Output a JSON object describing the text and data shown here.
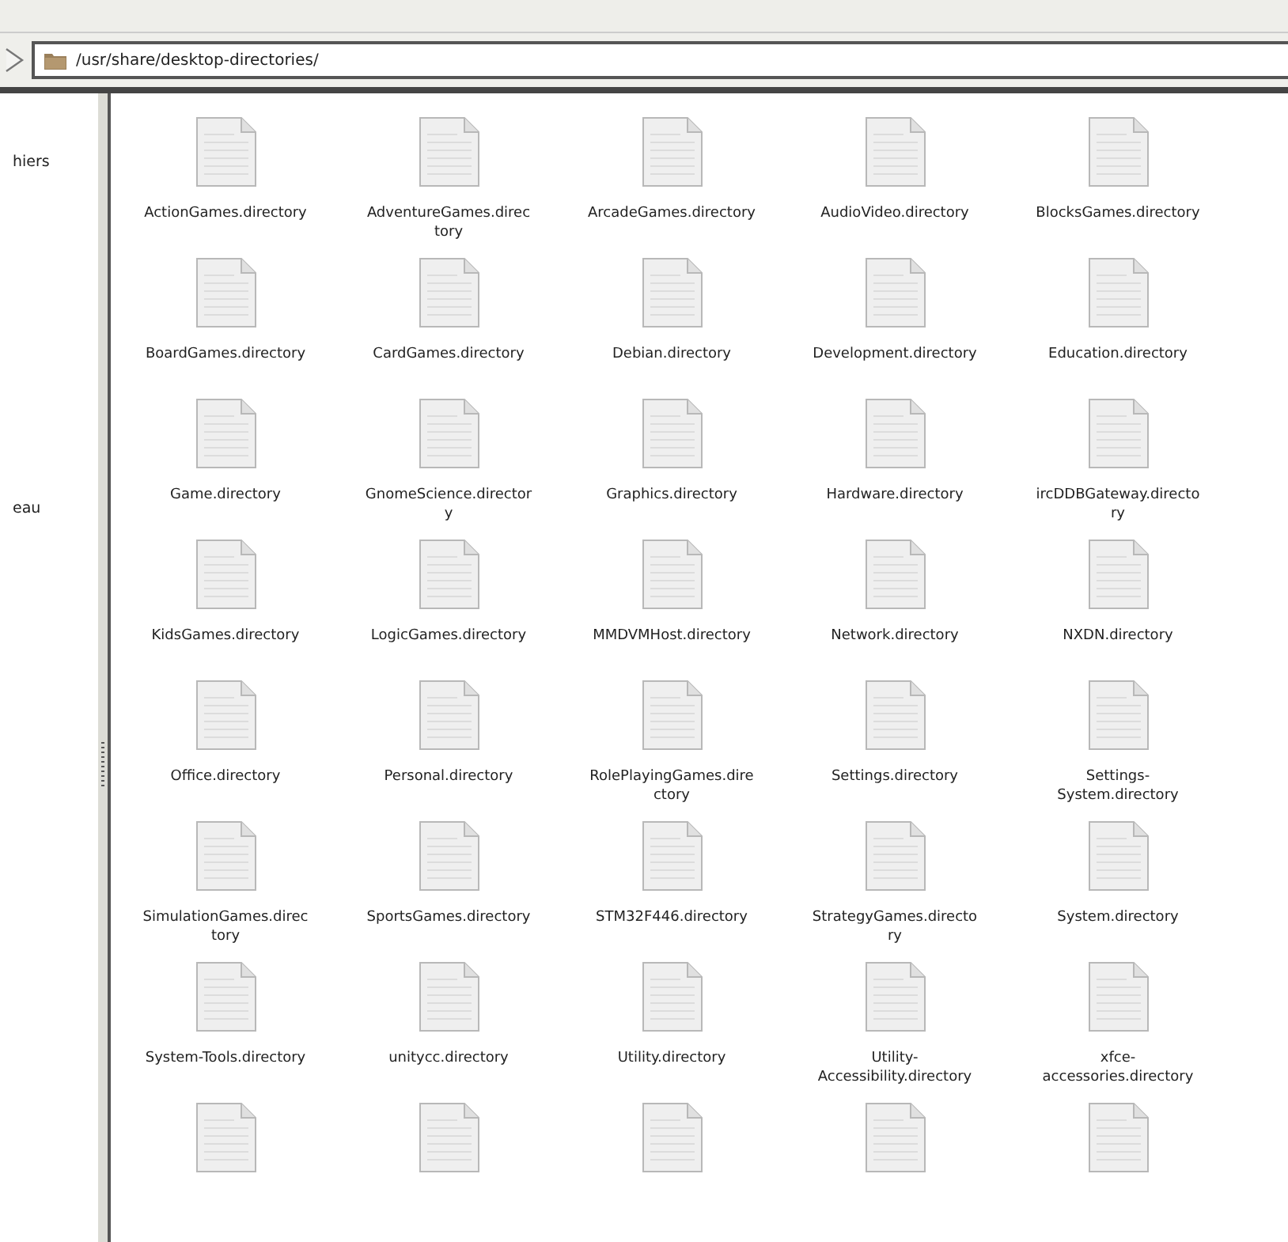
{
  "address_bar": {
    "path": "/usr/share/desktop-directories/"
  },
  "sidebar": {
    "items": [
      {
        "label": "hiers"
      },
      {
        "label": "eau"
      }
    ]
  },
  "files": [
    {
      "kind": "file",
      "name": "ActionGames.directory"
    },
    {
      "kind": "file",
      "name": "AdventureGames.directory"
    },
    {
      "kind": "file",
      "name": "ArcadeGames.directory"
    },
    {
      "kind": "file",
      "name": "AudioVideo.directory"
    },
    {
      "kind": "file",
      "name": "BlocksGames.directory"
    },
    {
      "kind": "file",
      "name": "BoardGames.directory"
    },
    {
      "kind": "file",
      "name": "CardGames.directory"
    },
    {
      "kind": "file",
      "name": "Debian.directory"
    },
    {
      "kind": "file",
      "name": "Development.directory"
    },
    {
      "kind": "file",
      "name": "Education.directory"
    },
    {
      "kind": "file",
      "name": "Game.directory"
    },
    {
      "kind": "file",
      "name": "GnomeScience.directory"
    },
    {
      "kind": "file",
      "name": "Graphics.directory"
    },
    {
      "kind": "file",
      "name": "Hardware.directory"
    },
    {
      "kind": "file",
      "name": "ircDDBGateway.directory"
    },
    {
      "kind": "file",
      "name": "KidsGames.directory"
    },
    {
      "kind": "file",
      "name": "LogicGames.directory"
    },
    {
      "kind": "file",
      "name": "MMDVMHost.directory"
    },
    {
      "kind": "file",
      "name": "Network.directory"
    },
    {
      "kind": "file",
      "name": "NXDN.directory"
    },
    {
      "kind": "file",
      "name": "Office.directory"
    },
    {
      "kind": "file",
      "name": "Personal.directory"
    },
    {
      "kind": "file",
      "name": "RolePlayingGames.directory"
    },
    {
      "kind": "file",
      "name": "Settings.directory"
    },
    {
      "kind": "file",
      "name": "Settings-System.directory"
    },
    {
      "kind": "file",
      "name": "SimulationGames.directory"
    },
    {
      "kind": "file",
      "name": "SportsGames.directory"
    },
    {
      "kind": "file",
      "name": "STM32F446.directory"
    },
    {
      "kind": "file",
      "name": "StrategyGames.directory"
    },
    {
      "kind": "file",
      "name": "System.directory"
    },
    {
      "kind": "file",
      "name": "System-Tools.directory"
    },
    {
      "kind": "file",
      "name": "unitycc.directory"
    },
    {
      "kind": "file",
      "name": "Utility.directory"
    },
    {
      "kind": "file",
      "name": "Utility-Accessibility.directory"
    },
    {
      "kind": "file",
      "name": "xfce-accessories.directory"
    },
    {
      "kind": "file"
    },
    {
      "kind": "file"
    },
    {
      "kind": "file"
    },
    {
      "kind": "file"
    },
    {
      "kind": "file"
    }
  ]
}
